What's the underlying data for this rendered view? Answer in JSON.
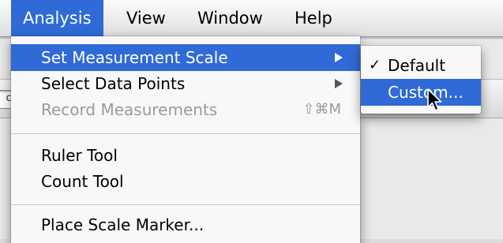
{
  "menubar": {
    "items": [
      {
        "label": "Analysis"
      },
      {
        "label": "View"
      },
      {
        "label": "Window"
      },
      {
        "label": "Help"
      }
    ]
  },
  "background": {
    "field_text": "cr"
  },
  "analysis_menu": {
    "items": [
      {
        "label": "Set Measurement Scale",
        "submenu": true,
        "highlighted": true
      },
      {
        "label": "Select Data Points",
        "submenu": true
      },
      {
        "label": "Record Measurements",
        "shortcut": "⇧⌘M",
        "disabled": true
      },
      {
        "label": "Ruler Tool"
      },
      {
        "label": "Count Tool"
      },
      {
        "label": "Place Scale Marker..."
      }
    ]
  },
  "scale_submenu": {
    "items": [
      {
        "label": "Default",
        "checked": true,
        "check_mark": "✓"
      },
      {
        "label": "Custom...",
        "highlighted": true
      }
    ]
  },
  "colors": {
    "highlight": "#2f6ad6",
    "disabled_text": "#9a9a9a"
  },
  "icons": {
    "cursor": "arrow-pointer-icon"
  }
}
